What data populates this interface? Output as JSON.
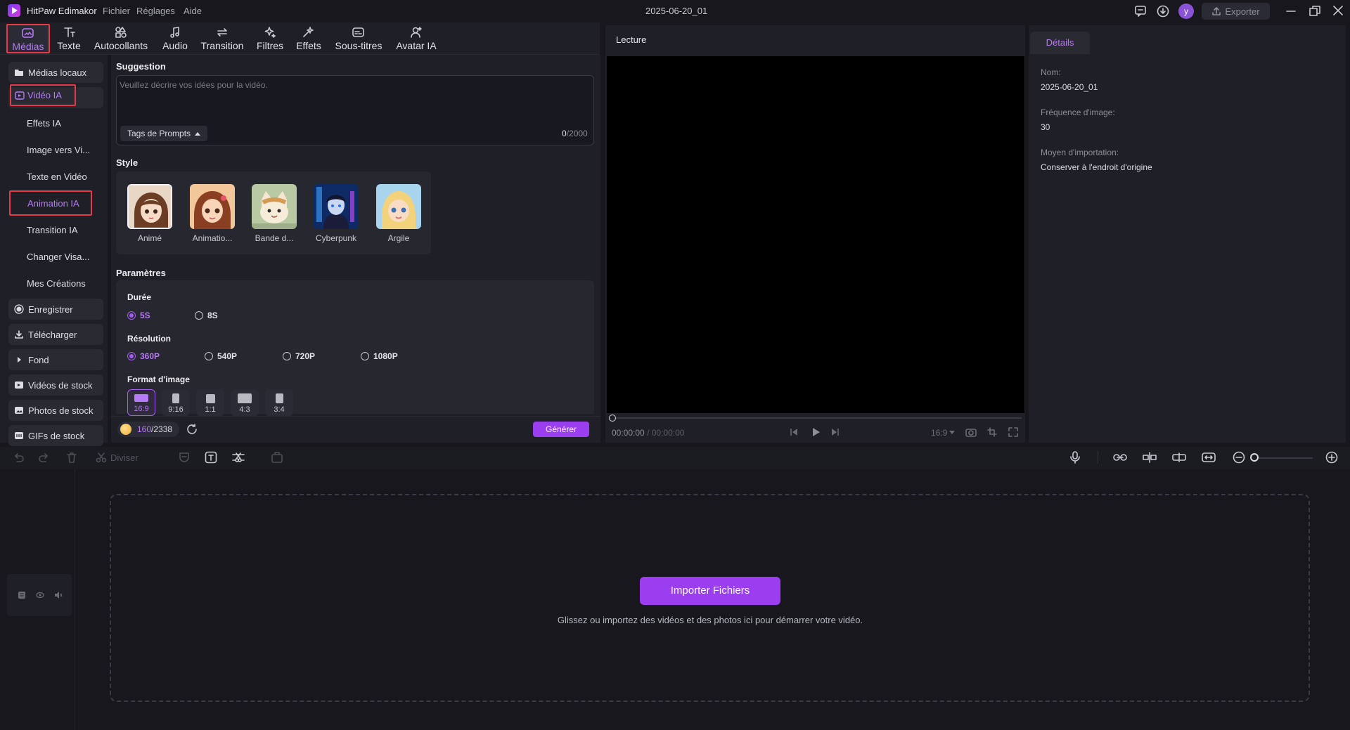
{
  "app": {
    "name": "HitPaw Edimakor",
    "menu": [
      "Fichier",
      "Réglages",
      "Aide"
    ],
    "project_title": "2025-06-20_01",
    "user_initial": "y",
    "export_label": "Exporter",
    "accent": "#a55cf6",
    "highlight": "#e8394a"
  },
  "toolbar": {
    "tabs": [
      {
        "label": "Médias",
        "icon": "media-icon"
      },
      {
        "label": "Texte",
        "icon": "text-icon"
      },
      {
        "label": "Autocollants",
        "icon": "stickers-icon"
      },
      {
        "label": "Audio",
        "icon": "audio-icon"
      },
      {
        "label": "Transition",
        "icon": "transition-icon"
      },
      {
        "label": "Filtres",
        "icon": "filters-icon"
      },
      {
        "label": "Effets",
        "icon": "effects-icon"
      },
      {
        "label": "Sous-titres",
        "icon": "subtitles-icon"
      },
      {
        "label": "Avatar IA",
        "icon": "avatar-icon"
      }
    ]
  },
  "sidebar": {
    "items": [
      {
        "label": "Médias locaux"
      },
      {
        "label": "Vidéo IA"
      },
      {
        "label": "Effets IA"
      },
      {
        "label": "Image vers Vi..."
      },
      {
        "label": "Texte en Vidéo"
      },
      {
        "label": "Animation IA"
      },
      {
        "label": "Transition IA"
      },
      {
        "label": "Changer Visa..."
      },
      {
        "label": "Mes Créations"
      },
      {
        "label": "Enregistrer"
      },
      {
        "label": "Télécharger"
      },
      {
        "label": "Fond"
      },
      {
        "label": "Vidéos de stock"
      },
      {
        "label": "Photos de stock"
      },
      {
        "label": "GIFs de stock"
      }
    ]
  },
  "generator": {
    "suggestion_title": "Suggestion",
    "prompt_placeholder": "Veuillez décrire vos idées pour la vidéo.",
    "tags_label": "Tags de Prompts",
    "char_count": "0",
    "char_max": "/2000",
    "style_title": "Style",
    "styles": [
      {
        "label": "Animé"
      },
      {
        "label": "Animatio..."
      },
      {
        "label": "Bande d..."
      },
      {
        "label": "Cyberpunk"
      },
      {
        "label": "Argile"
      }
    ],
    "params_title": "Paramètres",
    "duration_title": "Durée",
    "durations": [
      {
        "label": "5S",
        "selected": true
      },
      {
        "label": "8S",
        "selected": false
      }
    ],
    "resolution_title": "Résolution",
    "resolutions": [
      {
        "label": "360P",
        "selected": true
      },
      {
        "label": "540P",
        "selected": false
      },
      {
        "label": "720P",
        "selected": false
      },
      {
        "label": "1080P",
        "selected": false
      }
    ],
    "format_title": "Format d'image",
    "formats": [
      {
        "label": "16:9",
        "selected": true
      },
      {
        "label": "9:16",
        "selected": false
      },
      {
        "label": "1:1",
        "selected": false
      },
      {
        "label": "4:3",
        "selected": false
      },
      {
        "label": "3:4",
        "selected": false
      }
    ],
    "credits_used": "160",
    "credits_total": "/2338",
    "generate_label": "Générer"
  },
  "player": {
    "title": "Lecture",
    "time_current": "00:00:00",
    "time_total": "/ 00:00:00",
    "aspect": "16:9"
  },
  "details": {
    "tab": "Détails",
    "name_label": "Nom:",
    "name_value": "2025-06-20_01",
    "fps_label": "Fréquence d'image:",
    "fps_value": "30",
    "import_label": "Moyen d'importation:",
    "import_value": "Conserver à l'endroit d'origine"
  },
  "timeline": {
    "split_label": "Diviser",
    "import_button": "Importer Fichiers",
    "hint": "Glissez ou importez des vidéos et des photos ici pour démarrer votre vidéo."
  }
}
